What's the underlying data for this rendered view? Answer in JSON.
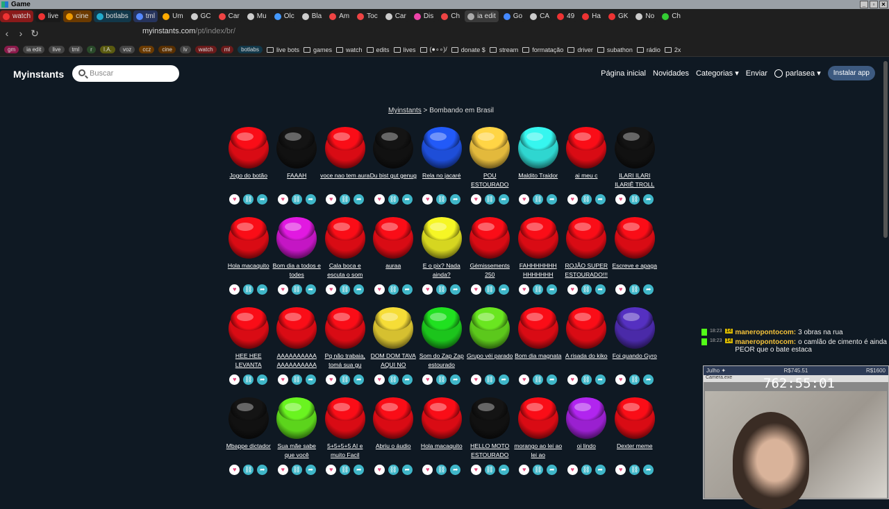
{
  "os": {
    "title": "Game"
  },
  "tabs": [
    {
      "label": "watch",
      "color": "#8a1a1a",
      "icon": "#e33"
    },
    {
      "label": "live",
      "color": "#1a1a1a",
      "icon": "#e33"
    },
    {
      "label": "cine",
      "color": "#6b3a00",
      "icon": "#e90"
    },
    {
      "label": "botlabs",
      "color": "#12384a",
      "icon": "#2ac"
    },
    {
      "label": "tml",
      "color": "#26335c",
      "icon": "#58f"
    },
    {
      "label": "Um",
      "color": "#1f1f1f",
      "icon": "#fa0"
    },
    {
      "label": "GC",
      "color": "#1f1f1f",
      "icon": "#ccc"
    },
    {
      "label": "Car",
      "color": "#1f1f1f",
      "icon": "#e44"
    },
    {
      "label": "Mu",
      "color": "#1f1f1f",
      "icon": "#ccc"
    },
    {
      "label": "Olc",
      "color": "#1f1f1f",
      "icon": "#49f"
    },
    {
      "label": "Bla",
      "color": "#1f1f1f",
      "icon": "#ccc"
    },
    {
      "label": "Am",
      "color": "#1f1f1f",
      "icon": "#e44"
    },
    {
      "label": "Toc",
      "color": "#1f1f1f",
      "icon": "#e44"
    },
    {
      "label": "Car",
      "color": "#1f1f1f",
      "icon": "#ccc"
    },
    {
      "label": "Dis",
      "color": "#1f1f1f",
      "icon": "#e4a"
    },
    {
      "label": "Ch",
      "color": "#1f1f1f",
      "icon": "#e44"
    },
    {
      "label": "ia edit",
      "color": "#3a3a3a",
      "icon": "#aaa"
    },
    {
      "label": "Go",
      "color": "#1f1f1f",
      "icon": "#48f"
    },
    {
      "label": "CA",
      "color": "#1f1f1f",
      "icon": "#ccc"
    },
    {
      "label": "49",
      "color": "#1f1f1f",
      "icon": "#e33"
    },
    {
      "label": "Ha",
      "color": "#1f1f1f",
      "icon": "#e33"
    },
    {
      "label": "GK",
      "color": "#1f1f1f",
      "icon": "#e33"
    },
    {
      "label": "No",
      "color": "#1f1f1f",
      "icon": "#ccc"
    },
    {
      "label": "Ch",
      "color": "#1f1f1f",
      "icon": "#3c3"
    }
  ],
  "address": {
    "host": "myinstants.com",
    "path": "/pt/index/br/"
  },
  "bookmarks": [
    {
      "label": "gm",
      "chip": "#8a1a4a"
    },
    {
      "label": "ia edit",
      "chip": "#444"
    },
    {
      "label": "live",
      "chip": "#444"
    },
    {
      "label": "tml",
      "chip": "#444"
    },
    {
      "label": "r",
      "chip": "#2a4a2a"
    },
    {
      "label": "I.A.",
      "chip": "#5a5a10"
    },
    {
      "label": "voz",
      "chip": "#444"
    },
    {
      "label": "ccz",
      "chip": "#6a3a00"
    },
    {
      "label": "cine",
      "chip": "#5a3000"
    },
    {
      "label": "lv",
      "chip": "#444"
    },
    {
      "label": "watch",
      "chip": "#6a1a1a"
    },
    {
      "label": "ml",
      "chip": "#6a1a1a"
    },
    {
      "label": "botlabs",
      "chip": "#12384a"
    }
  ],
  "bookmark_folders": [
    "live bots",
    "games",
    "watch",
    "edits",
    "lives",
    "(●∘∘)/",
    "donate $",
    "stream",
    "formatação",
    "driver",
    "subathon",
    "rádio",
    "2x"
  ],
  "site": {
    "logo": "Myinstants",
    "search_placeholder": "Buscar",
    "menu": {
      "home": "Página inicial",
      "new": "Novidades",
      "categories": "Categorias ▾",
      "send": "Enviar",
      "user": "parlasea ▾",
      "install": "Instalar app"
    },
    "breadcrumb_home": "Myinstants",
    "breadcrumb_sep": " > ",
    "breadcrumb_current": "Bombando em Brasil"
  },
  "buttons": [
    {
      "label": "Jogo do botão",
      "color": "#d90b14"
    },
    {
      "label": "FAAAH",
      "color": "#111111"
    },
    {
      "label": "voce nao tem aura",
      "color": "#d90b14"
    },
    {
      "label": "Du bist gut genug",
      "color": "#111111"
    },
    {
      "label": "Rela no jacaré",
      "color": "#1e4ed8"
    },
    {
      "label": "POU ESTOURADO",
      "color": "#e3b93c"
    },
    {
      "label": "Maldito Traidor",
      "color": "#2fd6d0"
    },
    {
      "label": "ai meu c",
      "color": "#d90b14"
    },
    {
      "label": "ILARI ILARI ILARIÊ TROLL",
      "color": "#111111"
    },
    {
      "label": "Hola macaquito",
      "color": "#d90b14"
    },
    {
      "label": "Bom dia a todos e todes",
      "color": "#c416c4"
    },
    {
      "label": "Cala boca e escuta o som",
      "color": "#d90b14"
    },
    {
      "label": "auraa",
      "color": "#d90b14"
    },
    {
      "label": "E o pix? Nada ainda?",
      "color": "#d6d620"
    },
    {
      "label": "Gémissements 250",
      "color": "#d90b14"
    },
    {
      "label": "FAHHHHHHH HHHHHHH",
      "color": "#d90b14"
    },
    {
      "label": "ROJÃO SUPER ESTOURADO!!!",
      "color": "#d90b14"
    },
    {
      "label": "Escreve e apaga",
      "color": "#d90b14"
    },
    {
      "label": "HEE HEE LEVANTA",
      "color": "#d90b14"
    },
    {
      "label": "AAAAAAAAAA AAAAAAAAAA",
      "color": "#d90b14"
    },
    {
      "label": "Pq não trabaia, tomá sua gu",
      "color": "#d90b14"
    },
    {
      "label": "DOM DOM TAVA AQUI NO",
      "color": "#d6c030"
    },
    {
      "label": "Som do Zap Zap estourado",
      "color": "#1cc41c"
    },
    {
      "label": "Grupo véi parado",
      "color": "#5cc81c"
    },
    {
      "label": "Bom dia magnata",
      "color": "#d90b14"
    },
    {
      "label": "A risada do kiko",
      "color": "#d90b14"
    },
    {
      "label": "Foi quando Gyro",
      "color": "#4a2aa8"
    },
    {
      "label": "Mbappe dictador",
      "color": "#111111"
    },
    {
      "label": "Sua mãe sabe que você",
      "color": "#5cd41c"
    },
    {
      "label": "5+5+5+5 AI e muito Facil",
      "color": "#d90b14"
    },
    {
      "label": "Abriu o áudio",
      "color": "#d90b14"
    },
    {
      "label": "Hola macaquito",
      "color": "#d90b14"
    },
    {
      "label": "HELLO MOTO ESTOURADO",
      "color": "#111111"
    },
    {
      "label": "morango ao lei ao lei ao",
      "color": "#d90b14"
    },
    {
      "label": "oi lindo",
      "color": "#9a20d0"
    },
    {
      "label": "Dexter meme",
      "color": "#d90b14"
    }
  ],
  "chat": [
    {
      "time": "18:23",
      "badge": "14",
      "user": "maneropontocom:",
      "text": "3 obras na rua"
    },
    {
      "time": "18:23",
      "badge": "14",
      "user": "maneropontocom:",
      "text": "o camlão de cimento é ainda PEOR que o bate estaca"
    }
  ],
  "overlay": {
    "left": "Julho ✦",
    "mid": "R$745.51",
    "right": "R$1600",
    "cam_title": "Camera.exe",
    "timer": "762:55:01"
  },
  "icons": {
    "heart": "heart-icon",
    "link": "link-icon",
    "share": "share-icon"
  }
}
